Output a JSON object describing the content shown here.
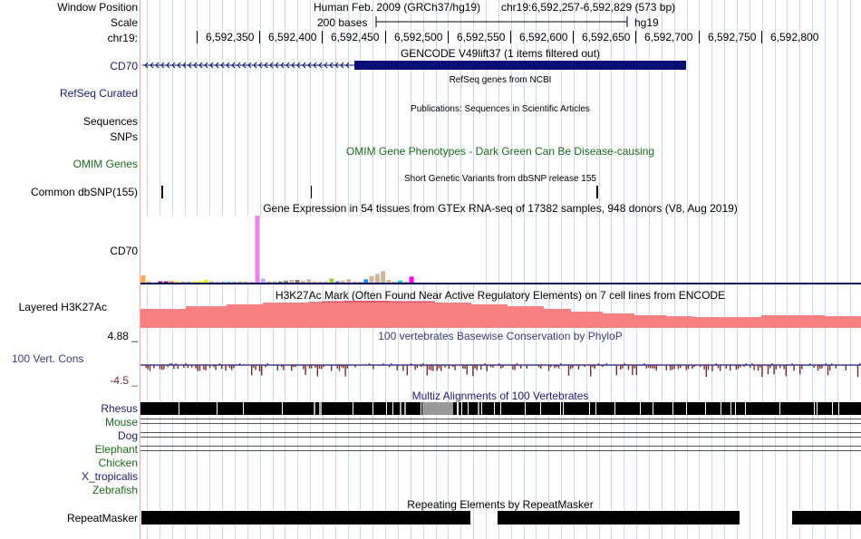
{
  "header": {
    "window_position_label": "Window Position",
    "scale_label": "Scale",
    "chrom_label": "chr19:",
    "assembly": "Human Feb. 2009 (GRCh37/hg19)",
    "position": "chr19:6,592,257-6,592,829 (573 bp)",
    "scale_bases": "200 bases",
    "db": "hg19",
    "ticks": [
      "6,592,350",
      "6,592,400",
      "6,592,450",
      "6,592,500",
      "6,592,550",
      "6,592,600",
      "6,592,650",
      "6,592,700",
      "6,592,750",
      "6,592,800"
    ]
  },
  "tracks": {
    "gencode": {
      "title": "GENCODE V49lift37 (1 items filtered out)",
      "gene": "CD70"
    },
    "refseq": {
      "label": "RefSeq Curated",
      "title": "RefSeq genes from NCBI"
    },
    "publications": {
      "label1": "Sequences",
      "label2": "SNPs",
      "title": "Publications: Sequences in Scientific Articles"
    },
    "omim": {
      "label": "OMIM Genes",
      "title": "OMIM Gene Phenotypes - Dark Green Can Be Disease-causing"
    },
    "dbsnp": {
      "label": "Common dbSNP(155)",
      "title": "Short Genetic Variants from dbSNP release 155"
    },
    "gtex": {
      "label": "CD70",
      "title": "Gene Expression in 54 tissues from GTEx RNA-seq of 17382 samples, 948 donors (V8, Aug 2019)"
    },
    "h3k27ac": {
      "label": "Layered H3K27Ac",
      "title": "H3K27Ac Mark (Often Found Near Active Regulatory Elements) on 7 cell lines from ENCODE",
      "color": "#f88080"
    },
    "phylop": {
      "label": "100 Vert. Cons",
      "title": "100 vertebrates Basewise Conservation by PhyloP",
      "max": "4.88 _",
      "min": "-4.5 _"
    },
    "multiz": {
      "title": "Multiz Alignments of 100 Vertebrates",
      "species": [
        "Rhesus",
        "Mouse",
        "Dog",
        "Elephant",
        "Chicken",
        "X_tropicalis",
        "Zebrafish"
      ]
    },
    "rmsk": {
      "label": "RepeatMasker",
      "title": "Repeating Elements by RepeatMasker"
    }
  },
  "colors": {
    "navy": "#0c0c78",
    "grid": "#ccdcf0",
    "gtex_axis": "#0c0c60"
  },
  "gtex_bars": [
    {
      "v": 11,
      "c": "#ffa54f"
    },
    {
      "v": 2,
      "c": "#eebb77"
    },
    {
      "v": 0,
      "c": "#cccccc"
    },
    {
      "v": 2,
      "c": "#8b1c62"
    },
    {
      "v": 2,
      "c": "#8b1c62"
    },
    {
      "v": 2,
      "c": "#ee6a50"
    },
    {
      "v": 1,
      "c": "#ffd700"
    },
    {
      "v": 2,
      "c": "#cdb79e"
    },
    {
      "v": 1,
      "c": "#b0b0b0"
    },
    {
      "v": 1,
      "c": "#eeee00"
    },
    {
      "v": 2,
      "c": "#eeee00"
    },
    {
      "v": 4,
      "c": "#eeee00"
    },
    {
      "v": 1,
      "c": "#8fbc8f"
    },
    {
      "v": 1,
      "c": "#ffb6c1"
    },
    {
      "v": 1,
      "c": "#9ac0cd"
    },
    {
      "v": 1,
      "c": "#9ac0cd"
    },
    {
      "v": 1,
      "c": "#9ac0cd"
    },
    {
      "v": 1,
      "c": "#cdaa7d"
    },
    {
      "v": 1,
      "c": "#cdaa7d"
    },
    {
      "v": 1,
      "c": "#ffb6c1"
    },
    {
      "v": 100,
      "c": "#ee82ee"
    },
    {
      "v": 6,
      "c": "#b3b3ff"
    },
    {
      "v": 2,
      "c": "#cdb79e"
    },
    {
      "v": 2,
      "c": "#9ac0cd"
    },
    {
      "v": 2,
      "c": "#8b8378"
    },
    {
      "v": 3,
      "c": "#8b8378"
    },
    {
      "v": 4,
      "c": "#cdb79e"
    },
    {
      "v": 4,
      "c": "#8b8378"
    },
    {
      "v": 3,
      "c": "#cdb79e"
    },
    {
      "v": 5,
      "c": "#cdb79e"
    },
    {
      "v": 2,
      "c": "#cdb79e"
    },
    {
      "v": 1,
      "c": "#cdb79e"
    },
    {
      "v": 1,
      "c": "#cdb79e"
    },
    {
      "v": 6,
      "c": "#9acd32"
    },
    {
      "v": 2,
      "c": "#7a67ee"
    },
    {
      "v": 3,
      "c": "#cdb79e"
    },
    {
      "v": 5,
      "c": "#cdb79e"
    },
    {
      "v": 1,
      "c": "#cdb79e"
    },
    {
      "v": 1,
      "c": "#cdb79e"
    },
    {
      "v": 5,
      "c": "#1e90ff"
    },
    {
      "v": 10,
      "c": "#cdb79e"
    },
    {
      "v": 13,
      "c": "#cdb79e"
    },
    {
      "v": 17,
      "c": "#cdb79e"
    },
    {
      "v": 4,
      "c": "#cdb79e"
    },
    {
      "v": 1,
      "c": "#cdb79e"
    },
    {
      "v": 3,
      "c": "#00cdcd"
    },
    {
      "v": 1,
      "c": "#cdb79e"
    },
    {
      "v": 9,
      "c": "#ff00ff"
    },
    {
      "v": 0,
      "c": "#cccccc"
    },
    {
      "v": 0,
      "c": "#cccccc"
    },
    {
      "v": 0,
      "c": "#cccccc"
    },
    {
      "v": 0,
      "c": "#cccccc"
    },
    {
      "v": 0,
      "c": "#cccccc"
    },
    {
      "v": 0,
      "c": "#cccccc"
    }
  ]
}
